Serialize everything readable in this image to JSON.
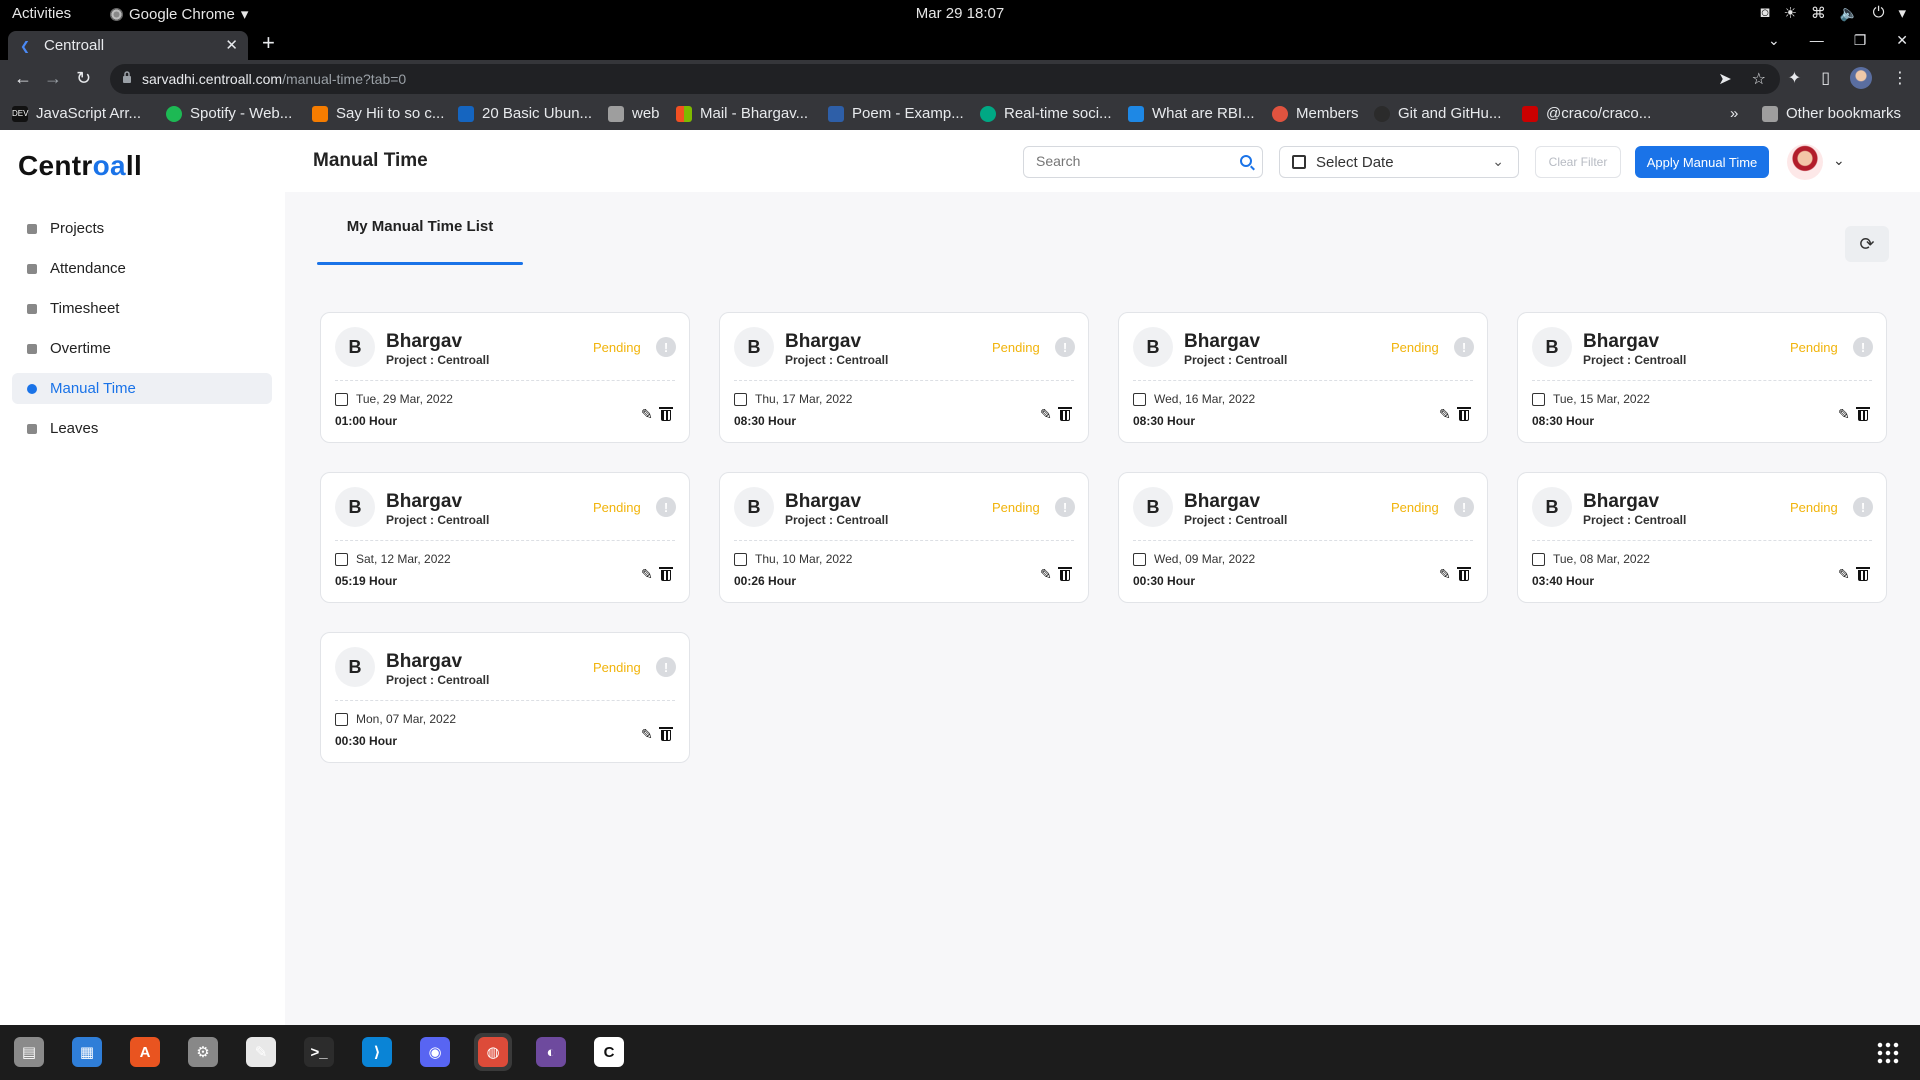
{
  "system": {
    "activities": "Activities",
    "app_name": "Google Chrome",
    "clock": "Mar 29  18:07"
  },
  "browser": {
    "tab_title": "Centroall",
    "url_host": "sarvadhi.centroall.com",
    "url_path": "/manual-time?tab=0",
    "bookmarks": [
      {
        "label": "JavaScript Arr...",
        "color": "#111111"
      },
      {
        "label": "Spotify - Web...",
        "color": "#1db954"
      },
      {
        "label": "Say Hii to so c...",
        "color": "#f57c00"
      },
      {
        "label": "20 Basic Ubun...",
        "color": "#1565c0"
      },
      {
        "label": "web",
        "color": "#9e9e9e"
      },
      {
        "label": "Mail - Bhargav...",
        "color": "#f25022"
      },
      {
        "label": "Poem - Examp...",
        "color": "#2e5fa8"
      },
      {
        "label": "Real-time soci...",
        "color": "#00a884"
      },
      {
        "label": "What are RBI...",
        "color": "#1e88e5"
      },
      {
        "label": "Members",
        "color": "#e0533f"
      },
      {
        "label": "Git and GitHu...",
        "color": "#2b2b2b"
      },
      {
        "label": "@craco/craco...",
        "color": "#cb0000"
      }
    ],
    "more": "»",
    "other_bookmarks": "Other bookmarks"
  },
  "app": {
    "logo_pre": "Centr",
    "logo_mid": "oa",
    "logo_post": "ll",
    "accent_color": "#1a73e8",
    "sidebar": {
      "items": [
        {
          "label": "Projects"
        },
        {
          "label": "Attendance"
        },
        {
          "label": "Timesheet"
        },
        {
          "label": "Overtime"
        },
        {
          "label": "Manual Time"
        },
        {
          "label": "Leaves"
        }
      ],
      "active": "Manual Time"
    },
    "header": {
      "title": "Manual Time",
      "search_placeholder": "Search",
      "select_date": "Select Date",
      "clear_filter": "Clear Filter",
      "apply_button": "Apply Manual Time"
    },
    "list": {
      "tab_label": "My Manual Time List",
      "cards": [
        {
          "initial": "B",
          "name": "Bhargav",
          "project": "Project : Centroall",
          "status": "Pending",
          "date": "Tue, 29 Mar, 2022",
          "hours": "01:00 Hour"
        },
        {
          "initial": "B",
          "name": "Bhargav",
          "project": "Project : Centroall",
          "status": "Pending",
          "date": "Thu, 17 Mar, 2022",
          "hours": "08:30 Hour"
        },
        {
          "initial": "B",
          "name": "Bhargav",
          "project": "Project : Centroall",
          "status": "Pending",
          "date": "Wed, 16 Mar, 2022",
          "hours": "08:30 Hour"
        },
        {
          "initial": "B",
          "name": "Bhargav",
          "project": "Project : Centroall",
          "status": "Pending",
          "date": "Tue, 15 Mar, 2022",
          "hours": "08:30 Hour"
        },
        {
          "initial": "B",
          "name": "Bhargav",
          "project": "Project : Centroall",
          "status": "Pending",
          "date": "Sat, 12 Mar, 2022",
          "hours": "05:19 Hour"
        },
        {
          "initial": "B",
          "name": "Bhargav",
          "project": "Project : Centroall",
          "status": "Pending",
          "date": "Thu, 10 Mar, 2022",
          "hours": "00:26 Hour"
        },
        {
          "initial": "B",
          "name": "Bhargav",
          "project": "Project : Centroall",
          "status": "Pending",
          "date": "Wed, 09 Mar, 2022",
          "hours": "00:30 Hour"
        },
        {
          "initial": "B",
          "name": "Bhargav",
          "project": "Project : Centroall",
          "status": "Pending",
          "date": "Tue, 08 Mar, 2022",
          "hours": "03:40 Hour"
        },
        {
          "initial": "B",
          "name": "Bhargav",
          "project": "Project : Centroall",
          "status": "Pending",
          "date": "Mon, 07 Mar, 2022",
          "hours": "00:30 Hour"
        }
      ],
      "status_color": "#f1b40c"
    }
  },
  "dock": {
    "apps": [
      {
        "icon": "files-icon",
        "color": "#8a8a8a"
      },
      {
        "icon": "text-editor-icon",
        "color": "#2f7ed8"
      },
      {
        "icon": "software-store-icon",
        "color": "#e95420"
      },
      {
        "icon": "settings-icon",
        "color": "#888888"
      },
      {
        "icon": "notes-icon",
        "color": "#e8e8e8"
      },
      {
        "icon": "terminal-icon",
        "color": "#2c2c2c"
      },
      {
        "icon": "vscode-icon",
        "color": "#0a84d6"
      },
      {
        "icon": "discord-icon",
        "color": "#5865f2"
      },
      {
        "icon": "chrome-icon",
        "color": "#dd4b39"
      },
      {
        "icon": "github-desktop-icon",
        "color": "#6e4a9e"
      },
      {
        "icon": "centroall-icon",
        "color": "#ffffff"
      }
    ],
    "active": "chrome-icon"
  }
}
